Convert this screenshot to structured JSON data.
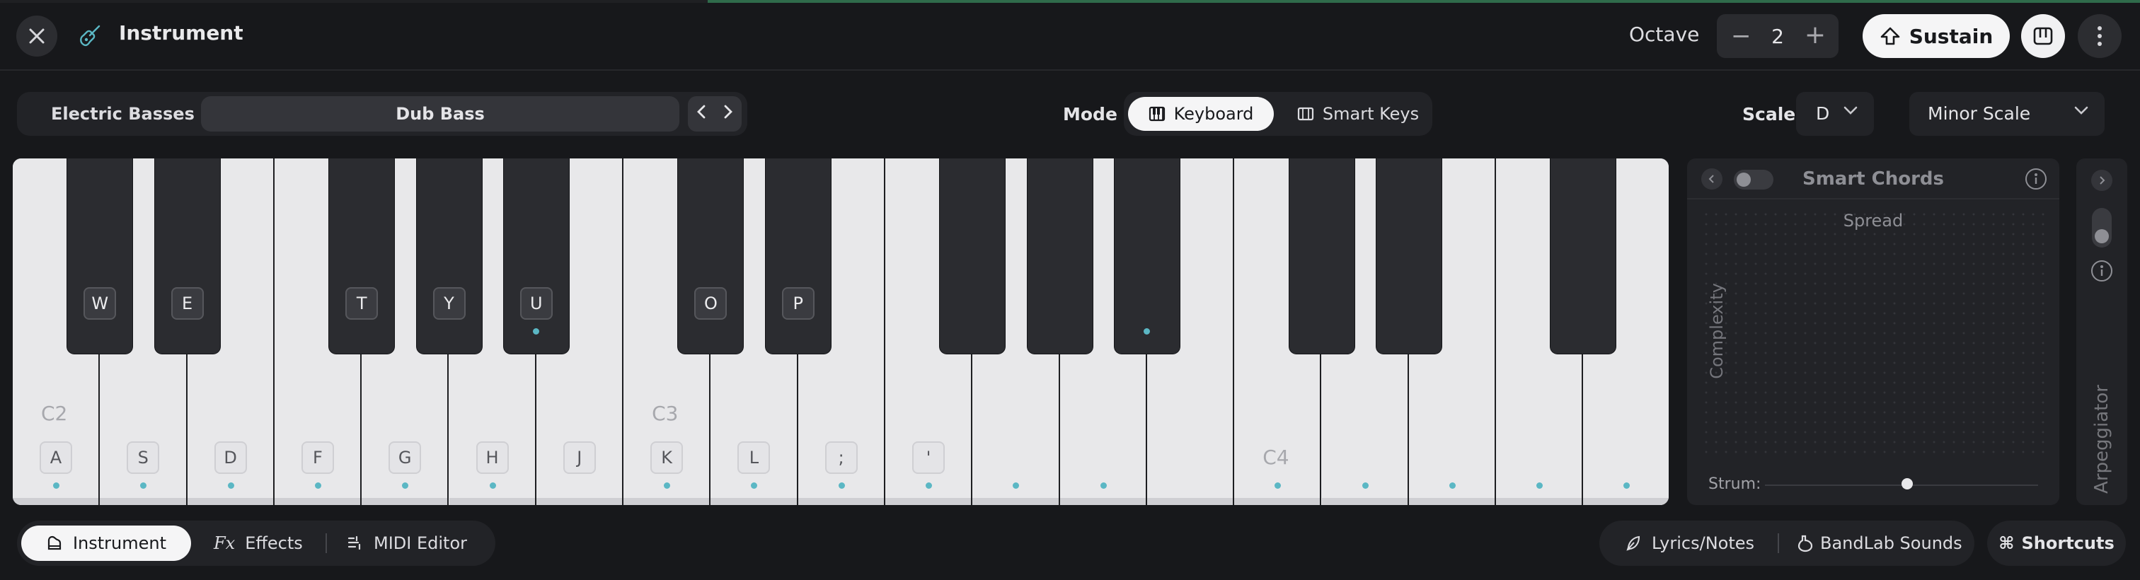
{
  "header": {
    "title": "Instrument",
    "octave_label": "Octave",
    "octave_value": "2",
    "sustain_label": "Sustain"
  },
  "instrument": {
    "category": "Electric Basses",
    "preset": "Dub Bass"
  },
  "mode": {
    "label": "Mode",
    "options": [
      "Keyboard",
      "Smart Keys"
    ],
    "selected": "Keyboard"
  },
  "scale": {
    "label": "Scale",
    "key": "D",
    "type": "Minor Scale"
  },
  "keyboard": {
    "white_keys": [
      {
        "label": "A",
        "note": "C2",
        "dot": true
      },
      {
        "label": "S",
        "note": "",
        "dot": true
      },
      {
        "label": "D",
        "note": "",
        "dot": true
      },
      {
        "label": "F",
        "note": "",
        "dot": true
      },
      {
        "label": "G",
        "note": "",
        "dot": true
      },
      {
        "label": "H",
        "note": "",
        "dot": true
      },
      {
        "label": "J",
        "note": "",
        "dot": false
      },
      {
        "label": "K",
        "note": "C3",
        "dot": true
      },
      {
        "label": "L",
        "note": "",
        "dot": true
      },
      {
        "label": ";",
        "note": "",
        "dot": true
      },
      {
        "label": "'",
        "note": "",
        "dot": true
      },
      {
        "label": "",
        "note": "",
        "dot": true
      },
      {
        "label": "",
        "note": "",
        "dot": true
      },
      {
        "label": "",
        "note": "",
        "dot": false
      },
      {
        "label": "",
        "note": "C4",
        "dot": true
      },
      {
        "label": "",
        "note": "",
        "dot": true
      },
      {
        "label": "",
        "note": "",
        "dot": true
      },
      {
        "label": "",
        "note": "",
        "dot": true
      },
      {
        "label": "",
        "note": "",
        "dot": true
      }
    ],
    "black_keys": [
      {
        "label": "W",
        "dot": false
      },
      {
        "label": "E",
        "dot": false
      },
      {
        "label": "T",
        "dot": false
      },
      {
        "label": "Y",
        "dot": false
      },
      {
        "label": "U",
        "dot": true
      },
      {
        "label": "O",
        "dot": false
      },
      {
        "label": "P",
        "dot": false
      },
      {
        "label": "",
        "dot": false
      },
      {
        "label": "",
        "dot": false
      },
      {
        "label": "",
        "dot": true
      },
      {
        "label": "",
        "dot": false
      },
      {
        "label": "",
        "dot": false
      },
      {
        "label": "",
        "dot": false
      }
    ]
  },
  "smart_chords": {
    "title": "Smart Chords",
    "spread_label": "Spread",
    "complexity_label": "Complexity",
    "strum_label": "Strum:",
    "strum_value": 0.52,
    "enabled": false
  },
  "arpeggiator": {
    "label": "Arpeggiator"
  },
  "bottom_tabs": {
    "items": [
      "Instrument",
      "Effects",
      "MIDI Editor"
    ],
    "fx_glyph": "Fx",
    "selected": "Instrument"
  },
  "utilities": {
    "lyrics": "Lyrics/Notes",
    "sounds": "BandLab Sounds",
    "shortcuts": "Shortcuts"
  },
  "colors": {
    "accent_dot": "#5bb7c4",
    "background": "#17181b"
  }
}
